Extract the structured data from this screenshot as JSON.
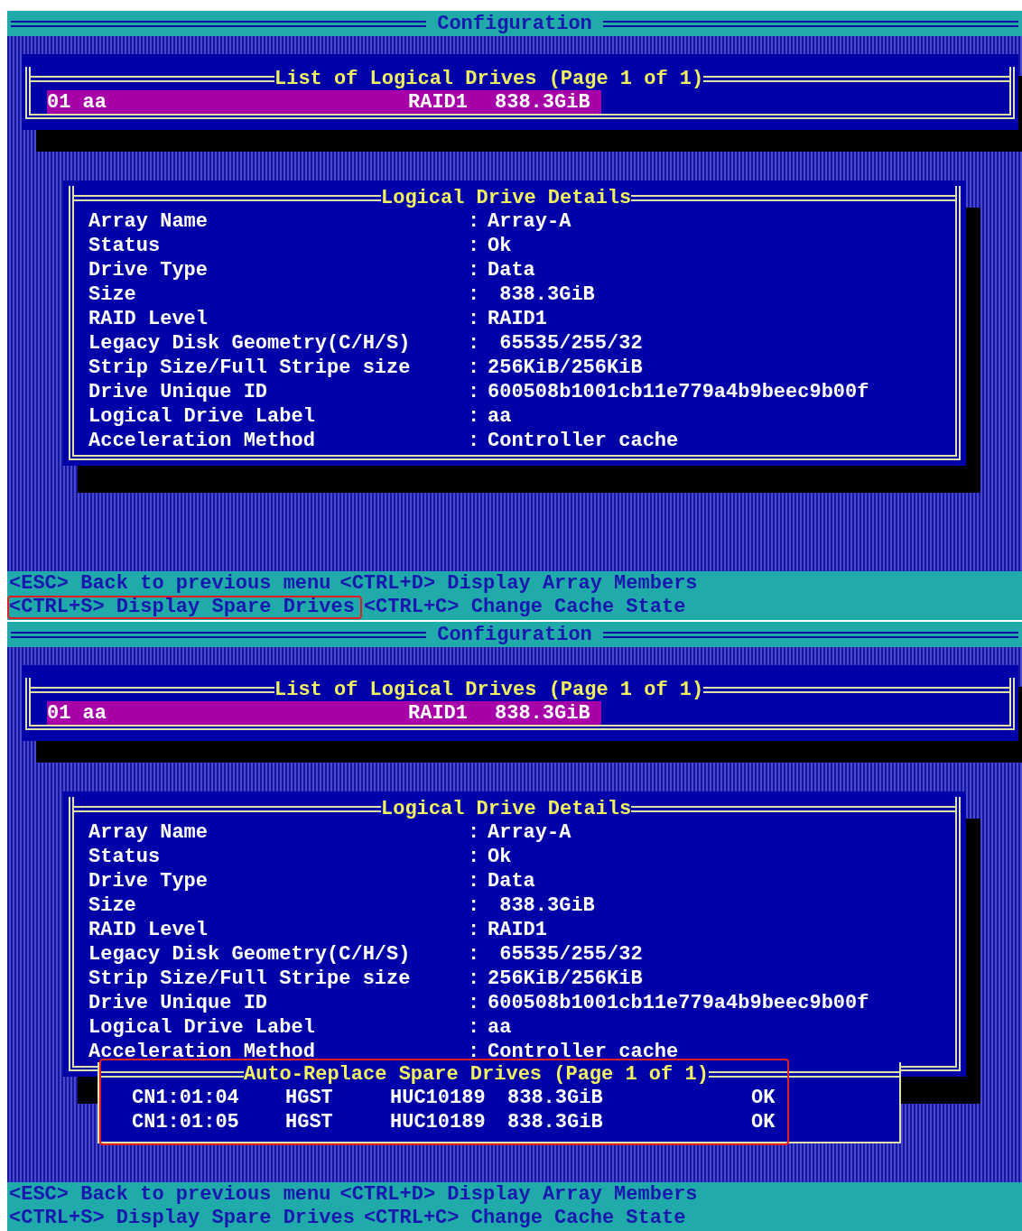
{
  "screens": [
    {
      "title": "Configuration",
      "list": {
        "title": "List of Logical Drives (Page 1 of 1)",
        "rows": [
          {
            "name": "01 aa",
            "raid": "RAID1",
            "size": "838.3GiB",
            "selected": true
          }
        ]
      },
      "details": {
        "title": "Logical Drive Details",
        "fields": [
          {
            "label": "Array Name",
            "separator": ":",
            "value": "Array-A"
          },
          {
            "label": "Status",
            "separator": ":",
            "value": "Ok"
          },
          {
            "label": "Drive Type",
            "separator": ":",
            "value": "Data"
          },
          {
            "label": "Size",
            "separator": ":",
            "value": " 838.3GiB"
          },
          {
            "label": "RAID Level",
            "separator": ":",
            "value": "RAID1"
          },
          {
            "label": "Legacy Disk Geometry(C/H/S)",
            "separator": ":",
            "value": " 65535/255/32"
          },
          {
            "label": "Strip Size/Full Stripe size",
            "separator": ":",
            "value": "256KiB/256KiB"
          },
          {
            "label": "Drive Unique ID",
            "separator": ":",
            "value": "600508b1001cb11e779a4b9beec9b00f"
          },
          {
            "label": "Logical Drive Label",
            "separator": ":",
            "value": "aa"
          },
          {
            "label": "Acceleration Method",
            "separator": ":",
            "value": "Controller cache"
          }
        ]
      },
      "footer": [
        [
          {
            "key": "<ESC>",
            "label": "Back to previous menu",
            "highlighted": false
          },
          {
            "key": "<CTRL+D>",
            "label": "Display Array Members",
            "highlighted": false
          }
        ],
        [
          {
            "key": "<CTRL+S>",
            "label": "Display Spare Drives",
            "highlighted": true
          },
          {
            "key": "<CTRL+C>",
            "label": "Change Cache State",
            "highlighted": false
          }
        ]
      ]
    },
    {
      "title": "Configuration",
      "list": {
        "title": "List of Logical Drives (Page 1 of 1)",
        "rows": [
          {
            "name": "01 aa",
            "raid": "RAID1",
            "size": "838.3GiB",
            "selected": true
          }
        ]
      },
      "details": {
        "title": "Logical Drive Details",
        "fields": [
          {
            "label": "Array Name",
            "separator": ":",
            "value": "Array-A"
          },
          {
            "label": "Status",
            "separator": ":",
            "value": "Ok"
          },
          {
            "label": "Drive Type",
            "separator": ":",
            "value": "Data"
          },
          {
            "label": "Size",
            "separator": ":",
            "value": " 838.3GiB"
          },
          {
            "label": "RAID Level",
            "separator": ":",
            "value": "RAID1"
          },
          {
            "label": "Legacy Disk Geometry(C/H/S)",
            "separator": ":",
            "value": " 65535/255/32"
          },
          {
            "label": "Strip Size/Full Stripe size",
            "separator": ":",
            "value": "256KiB/256KiB"
          },
          {
            "label": "Drive Unique ID",
            "separator": ":",
            "value": "600508b1001cb11e779a4b9beec9b00f"
          },
          {
            "label": "Logical Drive Label",
            "separator": ":",
            "value": "aa"
          },
          {
            "label": "Acceleration Method",
            "separator": ":",
            "value": "Controller cache"
          }
        ]
      },
      "spares": {
        "title": "Auto-Replace Spare Drives (Page 1 of 1)",
        "highlighted": true,
        "rows": [
          {
            "port": "CN1:01:04",
            "vendor": "HGST",
            "model": "HUC10189",
            "size": "838.3GiB",
            "status": "OK"
          },
          {
            "port": "CN1:01:05",
            "vendor": "HGST",
            "model": "HUC10189",
            "size": "838.3GiB",
            "status": "OK"
          }
        ]
      },
      "footer": [
        [
          {
            "key": "<ESC>",
            "label": "Back to previous menu",
            "highlighted": false
          },
          {
            "key": "<CTRL+D>",
            "label": "Display Array Members",
            "highlighted": false
          }
        ],
        [
          {
            "key": "<CTRL+S>",
            "label": "Display Spare Drives",
            "highlighted": false
          },
          {
            "key": "<CTRL+C>",
            "label": "Change Cache State",
            "highlighted": false
          }
        ]
      ]
    }
  ]
}
